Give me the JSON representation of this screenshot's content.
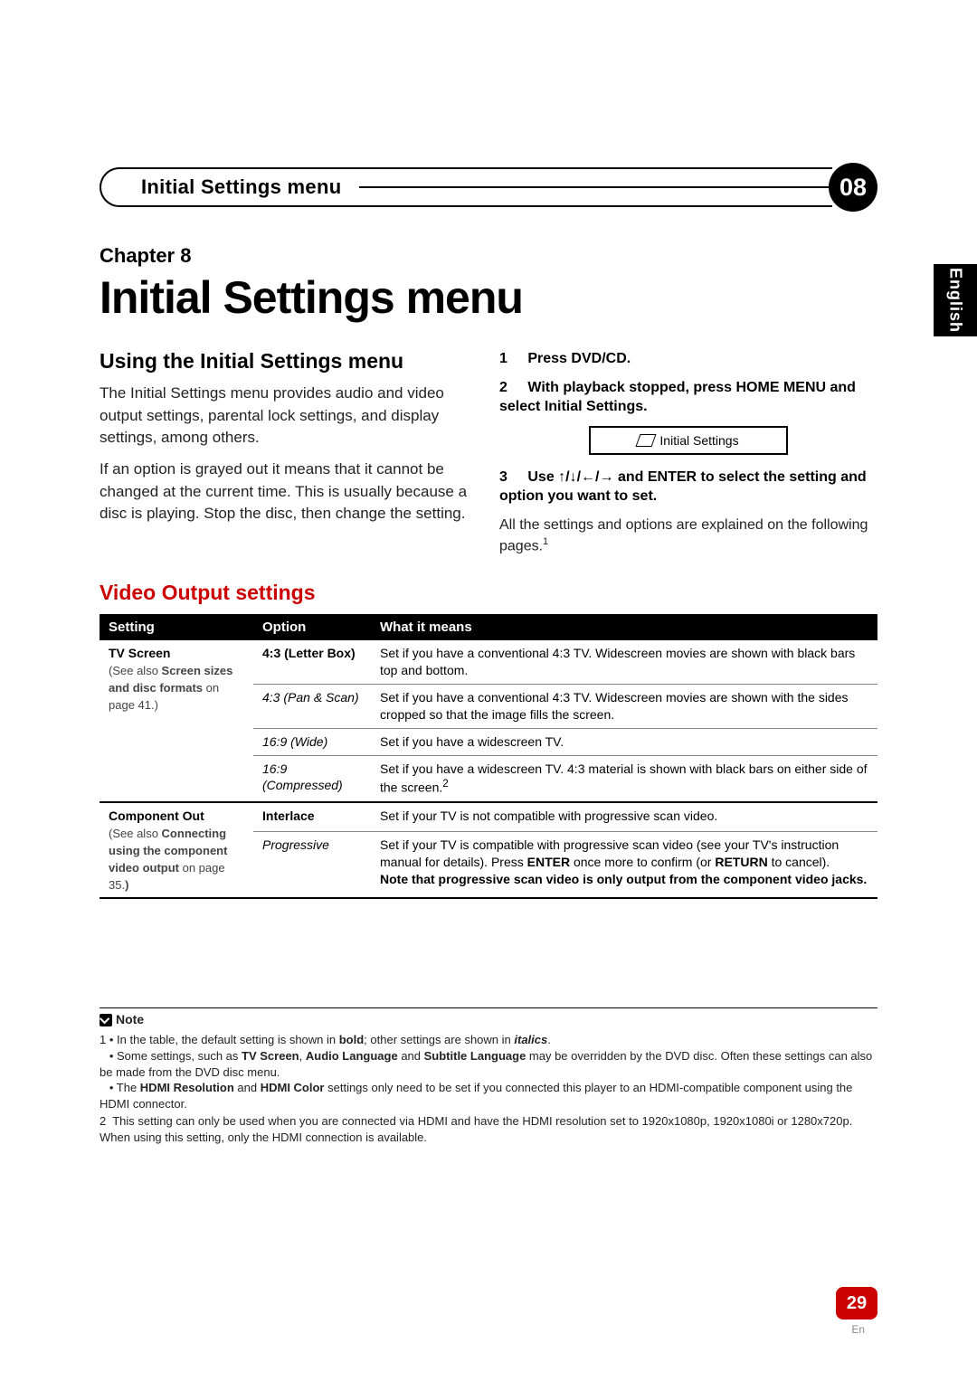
{
  "header": {
    "title": "Initial Settings menu",
    "badge_num": "08"
  },
  "side_tab": "English",
  "chapter_label": "Chapter 8",
  "main_title": "Initial Settings menu",
  "intro": {
    "heading": "Using the Initial Settings menu",
    "p1": "The Initial Settings menu provides audio and video output settings, parental lock settings, and display settings, among others.",
    "p2": "If an option is grayed out it means that it cannot be changed at the current time. This is usually because a disc is playing. Stop the disc, then change the setting."
  },
  "steps": {
    "s1_num": "1",
    "s1_text_a": "Press ",
    "s1_text_b": "DVD/CD",
    "s1_text_c": ".",
    "s2_num": "2",
    "s2_text_a": "With playback stopped, press ",
    "s2_text_b": "HOME MENU",
    "s2_text_c": " and select Initial Settings.",
    "osd_label": "Initial Settings",
    "s3_num": "3",
    "s3_text_a": "Use ",
    "s3_arrows": "↑/↓/←/→",
    "s3_text_b": " and ",
    "s3_enter": "ENTER",
    "s3_text_c": " to select the setting and option you want to set.",
    "s3_p2_a": "All the settings and options are explained on the following pages.",
    "s3_sup": "1"
  },
  "video_heading": "Video Output settings",
  "table": {
    "headers": [
      "Setting",
      "Option",
      "What it means"
    ],
    "rows": [
      {
        "setting_lines": [
          "<b>TV Screen</b>",
          "(See also <b>Screen sizes and disc formats</b> on page 41.)"
        ],
        "setting_rowspan": 4,
        "option": "<b>4:3 (Letter Box)</b>",
        "desc": "Set if you have a conventional 4:3 TV. Widescreen movies are shown with black bars top and bottom."
      },
      {
        "option": "<i>4:3 (Pan & Scan)</i>",
        "desc": "Set if you have a conventional 4:3 TV. Widescreen movies are shown with the sides cropped so that the image fills the screen."
      },
      {
        "option": "<i>16:9 (Wide)</i>",
        "desc": "Set if you have a widescreen TV."
      },
      {
        "option": "<i>16:9 (Compressed)</i>",
        "desc": "Set if you have a widescreen TV. 4:3 material is shown with black bars on either side of the screen.<sup>2</sup>",
        "last": true
      },
      {
        "setting_lines": [
          "<b>Component Out</b>",
          "(See also <b>Connecting using the component video output</b> on page 35.<b>)</b>"
        ],
        "setting_rowspan": 2,
        "option": "<b>Interlace</b>",
        "desc": "Set if your TV is not compatible with progressive scan video."
      },
      {
        "option": "<i>Progressive</i>",
        "desc": "Set if your TV is compatible with progressive scan video (see your TV's instruction manual for details). Press <b>ENTER</b> once more to confirm (or <b>RETURN</b> to cancel).<br><b>Note that progressive scan video is only output from the component video jacks.</b>",
        "last": true
      }
    ]
  },
  "notes": {
    "label": "Note",
    "n1_pre": "1",
    "n1_a": "• In the table, the default setting is shown in ",
    "n1_bold": "bold",
    "n1_b": "; other settings are shown in ",
    "n1_italics": "italics",
    "n1_c": ".",
    "n1_line2_a": "• Some settings, such as ",
    "n1_b1": "TV Screen",
    "n1_line2_b": ", ",
    "n1_b2": "Audio Language",
    "n1_line2_c": " and ",
    "n1_b3": "Subtitle Language",
    "n1_line2_d": " may be overridden by the DVD disc. Often these settings can also be made from the DVD disc menu.",
    "n1_line3_a": "• The ",
    "n1_b4": "HDMI Resolution",
    "n1_line3_b": " and ",
    "n1_b5": "HDMI Color",
    "n1_line3_c": " settings only need to be set if you connected this player to an HDMI-compatible component using the HDMI connector.",
    "n2_pre": "2",
    "n2": "This setting can only be used when you are connected via HDMI and have the HDMI resolution set to 1920x1080p, 1920x1080i or 1280x720p. When using this setting, only the HDMI connection is available."
  },
  "page_num": "29",
  "page_lang": "En"
}
